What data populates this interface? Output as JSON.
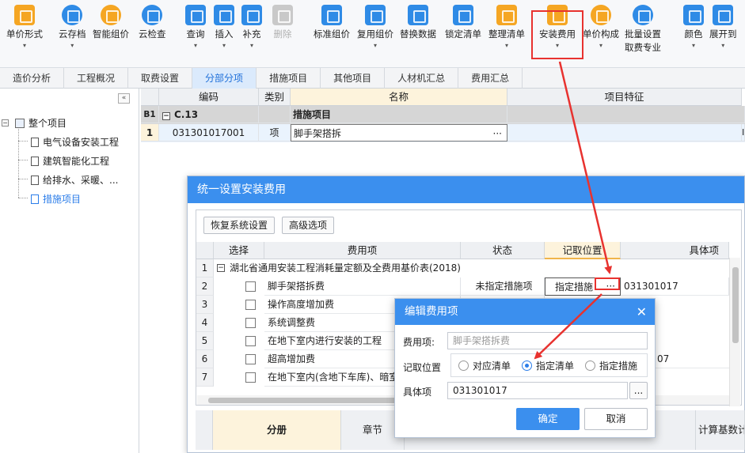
{
  "toolbar": {
    "items": [
      {
        "label": "单价形式",
        "icon": "unit-price-form-icon"
      },
      {
        "label": "云存档",
        "icon": "cloud-save-icon"
      },
      {
        "label": "智能组价",
        "icon": "smart-pricing-icon"
      },
      {
        "label": "云检查",
        "icon": "cloud-check-icon"
      },
      {
        "label": "查询",
        "icon": "query-icon"
      },
      {
        "label": "插入",
        "icon": "insert-icon"
      },
      {
        "label": "补充",
        "icon": "supplement-icon"
      },
      {
        "label": "删除",
        "icon": "delete-icon"
      },
      {
        "label": "标准组价",
        "icon": "standard-pricing-icon"
      },
      {
        "label": "复用组价",
        "icon": "reuse-pricing-icon"
      },
      {
        "label": "替换数据",
        "icon": "replace-data-icon"
      },
      {
        "label": "锁定清单",
        "icon": "lock-list-icon"
      },
      {
        "label": "整理清单",
        "icon": "organize-list-icon"
      },
      {
        "label": "安装费用",
        "icon": "install-fee-icon"
      },
      {
        "label": "单价构成",
        "icon": "unit-price-composition-icon"
      },
      {
        "label": "批量设置",
        "label2": "取费专业",
        "icon": "batch-settings-icon"
      },
      {
        "label": "颜色",
        "icon": "color-icon"
      },
      {
        "label": "展开到",
        "icon": "expand-to-icon"
      }
    ]
  },
  "tabs": [
    "造价分析",
    "工程概况",
    "取费设置",
    "分部分项",
    "措施项目",
    "其他项目",
    "人材机汇总",
    "费用汇总"
  ],
  "active_tab": "分部分项",
  "tree": {
    "collapse_glyph": "«",
    "root": "整个项目",
    "children": [
      "电气设备安装工程",
      "建筑智能化工程",
      "给排水、采暖、...",
      "措施项目"
    ],
    "selected": "措施项目"
  },
  "grid": {
    "headers": [
      "编码",
      "类别",
      "名称",
      "项目特征"
    ],
    "rows": [
      {
        "num": "B1",
        "code": "C.13",
        "type": "",
        "name": "措施项目"
      },
      {
        "num": "1",
        "code": "031301017001",
        "type": "项",
        "name": "脚手架搭拆"
      }
    ],
    "ellipsis": "···",
    "edge_char": "I"
  },
  "modal1": {
    "title": "统一设置安装费用",
    "restore_btn": "恢复系统设置",
    "advanced_btn": "高级选项",
    "headers": [
      "选择",
      "费用项",
      "状态",
      "记取位置",
      "具体项"
    ],
    "group_row": {
      "num": "1",
      "text": "湖北省通用安装工程消耗量定额及全费用基价表(2018)"
    },
    "rows": [
      {
        "num": "2",
        "item": "脚手架搭拆费",
        "status": "未指定措施项",
        "position": "指定措施",
        "detail": "031301017"
      },
      {
        "num": "3",
        "item": "操作高度增加费",
        "status": "",
        "position": "",
        "detail": ""
      },
      {
        "num": "4",
        "item": "系统调整费",
        "status": "",
        "position": "",
        "detail": ""
      },
      {
        "num": "5",
        "item": "在地下室内进行安装的工程",
        "status": "",
        "position": "",
        "detail": ""
      },
      {
        "num": "6",
        "item": "超高增加费",
        "status": "",
        "position": "",
        "detail": "07"
      },
      {
        "num": "7",
        "item": "在地下室内(含地下车库)、暗室",
        "status": "",
        "position": "",
        "detail": ""
      }
    ],
    "bottom_headers": [
      "分册",
      "章节",
      "计算基数计"
    ],
    "ellipsis": "···"
  },
  "modal2": {
    "title": "编辑费用项",
    "close": "✕",
    "fee_label": "费用项:",
    "fee_value": "脚手架搭拆费",
    "position_label": "记取位置",
    "options": [
      "对应清单",
      "指定清单",
      "指定措施"
    ],
    "selected_option": "指定清单",
    "detail_label": "具体项",
    "detail_value": "031301017",
    "detail_btn": "...",
    "ok": "确定",
    "cancel": "取消"
  },
  "colors": {
    "accent": "#3b8fee",
    "highlight": "#e8322f",
    "selected_tab": "#dbeafc"
  }
}
